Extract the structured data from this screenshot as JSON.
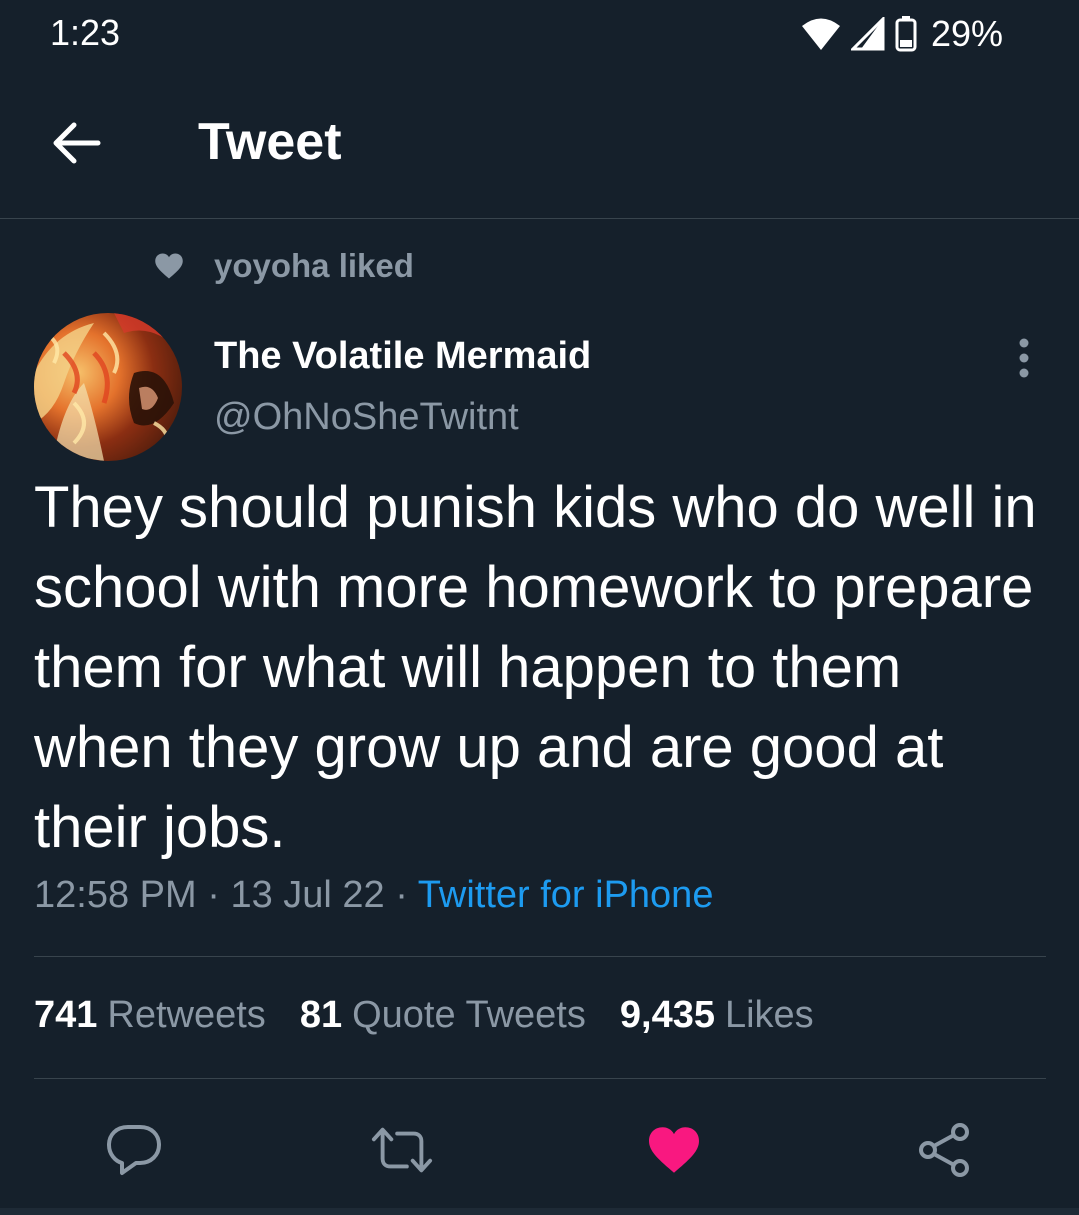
{
  "status_bar": {
    "time": "1:23",
    "battery": "29%",
    "icons": [
      "wifi-icon",
      "signal-icon",
      "battery-icon"
    ]
  },
  "header": {
    "title": "Tweet",
    "back_icon": "back-arrow-icon"
  },
  "social_context": {
    "text": "yoyoha liked",
    "icon": "heart-icon"
  },
  "tweet": {
    "author_name": "The Volatile Mermaid",
    "author_handle": "@OhNoSheTwitnt",
    "text": "They should punish kids who do well in school with more homework to prepare them for what will happen to them when they grow up and are good at their jobs.",
    "time": "12:58 PM",
    "date": "13 Jul 22",
    "separator": "·",
    "source": "Twitter for iPhone"
  },
  "stats": {
    "retweets_count": "741",
    "retweets_label": "Retweets",
    "quotes_count": "81",
    "quotes_label": "Quote Tweets",
    "likes_count": "9,435",
    "likes_label": "Likes"
  },
  "actions": [
    {
      "name": "reply",
      "icon": "reply-icon"
    },
    {
      "name": "retweet",
      "icon": "retweet-icon"
    },
    {
      "name": "like",
      "icon": "heart-icon",
      "active": true
    },
    {
      "name": "share",
      "icon": "share-icon"
    }
  ],
  "colors": {
    "background": "#15202b",
    "text_primary": "#ffffff",
    "text_secondary": "#8b98a5",
    "accent": "#1d9bf0",
    "like_active": "#f91880",
    "divider": "#38444d"
  }
}
